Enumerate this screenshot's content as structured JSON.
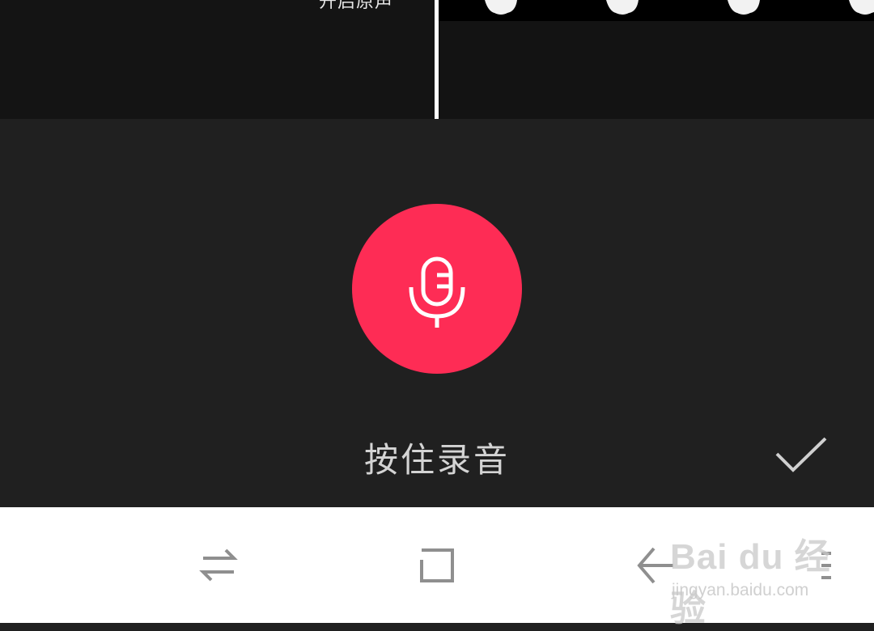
{
  "timeline": {
    "original_sound_label": "开启原声"
  },
  "record": {
    "hold_to_record_label": "按住录音",
    "button_color": "#fe2c55",
    "mic_icon": "microphone-icon",
    "confirm_icon": "checkmark-icon"
  },
  "nav_bar": {
    "switch_icon": "swap-arrows-icon",
    "home_icon": "square-icon",
    "back_icon": "back-arrow-icon",
    "menu_icon": "menu-icon"
  },
  "watermark": {
    "logo_text": "Bai du 经验",
    "site_text": "jingyan.baidu.com"
  }
}
